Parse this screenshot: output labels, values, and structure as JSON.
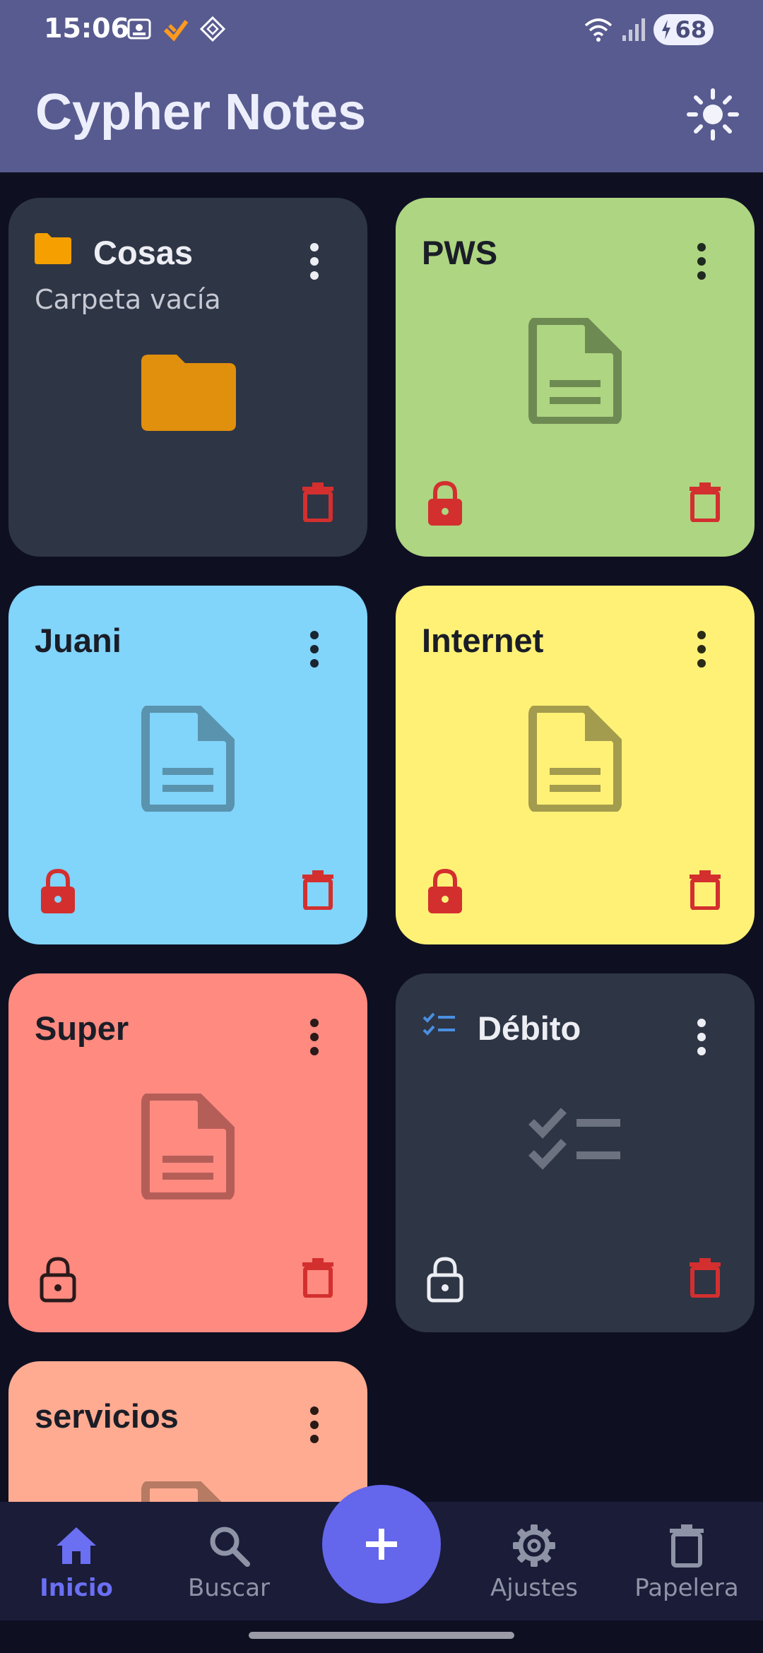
{
  "status": {
    "time": "15:06",
    "battery": "68"
  },
  "app": {
    "title": "Cypher Notes",
    "theme_icon": "sun-icon"
  },
  "cards": [
    {
      "title": "Cosas",
      "subtitle": "Carpeta vacía",
      "type": "folder",
      "bg": "#2e3545"
    },
    {
      "title": "PWS",
      "type": "note",
      "bg": "#aed581",
      "locked": true
    },
    {
      "title": "Juani",
      "type": "note",
      "bg": "#81d4fa",
      "locked": true
    },
    {
      "title": "Internet",
      "type": "note",
      "bg": "#fff176",
      "locked": true
    },
    {
      "title": "Super",
      "type": "note",
      "bg": "#ff8a80",
      "locked": false
    },
    {
      "title": "Débito",
      "type": "checklist",
      "bg": "#2e3545",
      "locked": false
    },
    {
      "title": "servicios",
      "type": "note",
      "bg": "#ffab91"
    }
  ],
  "nav": {
    "home": "Inicio",
    "search": "Buscar",
    "settings": "Ajustes",
    "trash": "Papelera",
    "add_icon": "plus-icon"
  },
  "colors": {
    "appbar": "#585b8f",
    "background": "#0e1022",
    "accent": "#6466ec",
    "danger": "#d32f2f",
    "folder": "#f5a000"
  }
}
